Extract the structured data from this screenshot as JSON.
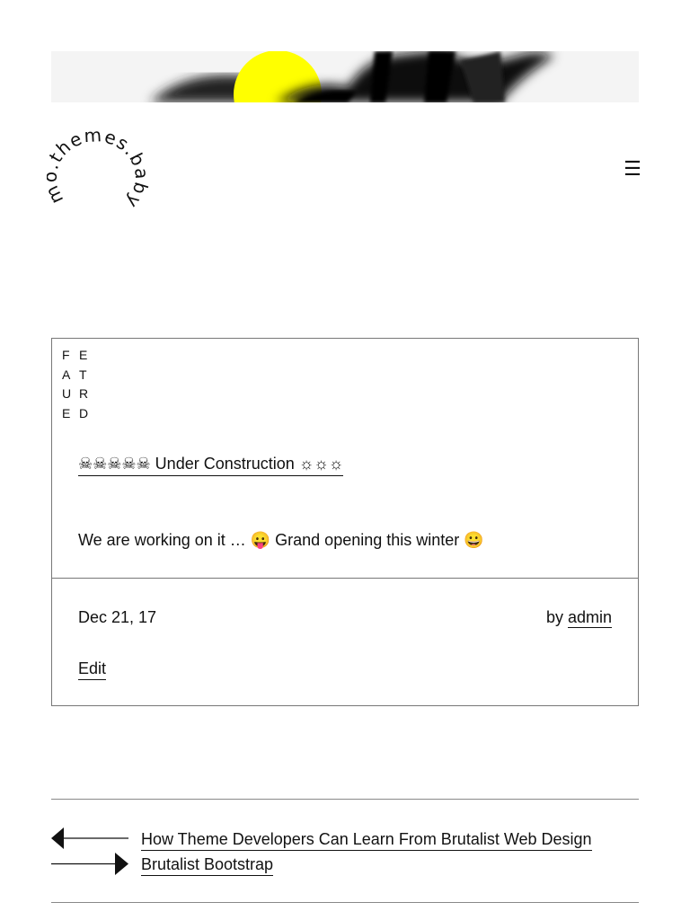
{
  "site": {
    "logo_text": "mo.themes.baby",
    "menu_icon": "hamburger-icon",
    "banner": {
      "accent": "#ffff00",
      "background": "#f5f5f5"
    }
  },
  "post": {
    "featured_label": [
      "F",
      "E",
      "A",
      "T",
      "U",
      "R",
      "E",
      "D"
    ],
    "title": "☠☠☠☠☠ Under Construction ☼☼☼",
    "excerpt": "We are working on it … 😛 Grand opening this winter 😀",
    "date": "Dec 21, 17",
    "by_label": "by",
    "author": "admin",
    "edit_label": "Edit"
  },
  "post_nav": {
    "previous": "How Theme Developers Can Learn From Brutalist Web Design",
    "next": "Brutalist Bootstrap"
  }
}
